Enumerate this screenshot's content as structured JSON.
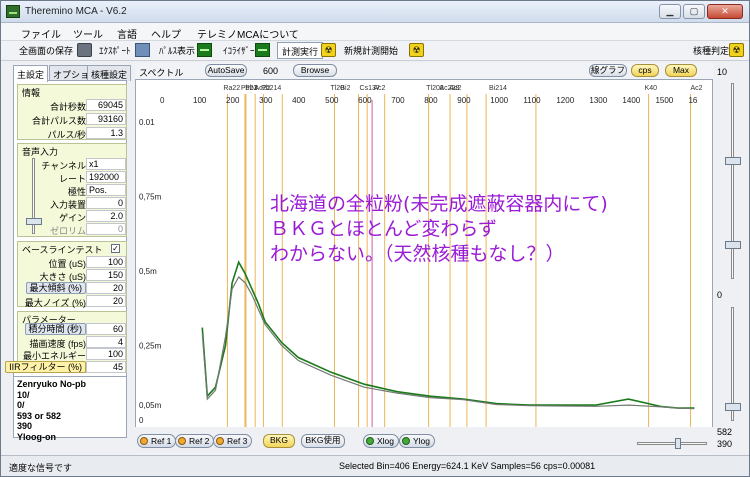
{
  "window": {
    "title": "Theremino MCA - V6.2"
  },
  "menu": [
    "ファイル",
    "ツール",
    "言語",
    "ヘルプ",
    "テレミノMCAについて"
  ],
  "toolbar": {
    "save_screen": "全画面の保存",
    "export": "ｴｸｽﾎﾟｰﾄ",
    "pulse_display": "ﾊﾟﾙｽ表示",
    "equalizer": "ｲｺﾗｲｻﾞｰ",
    "run_measure": "計測実行",
    "new_measure": "新規計測開始",
    "nuclide_identify": "核種判定"
  },
  "tabs": [
    "主設定",
    "オプション",
    "核種設定"
  ],
  "info": {
    "header": "情報",
    "rows": [
      {
        "label": "合計秒数",
        "value": "69045"
      },
      {
        "label": "合計パルス数",
        "value": "93160"
      },
      {
        "label": "パルス/秒",
        "value": "1.3"
      }
    ]
  },
  "audio": {
    "header": "音声入力",
    "rows": [
      {
        "label": "チャンネル",
        "value": "x1"
      },
      {
        "label": "レート",
        "value": "192000"
      },
      {
        "label": "極性",
        "value": "Pos."
      },
      {
        "label": "入力装置",
        "value": "0"
      },
      {
        "label": "ゲイン",
        "value": "2.0"
      },
      {
        "label": "ゼロリム",
        "value": "0"
      }
    ]
  },
  "baseline": {
    "header": "ベースラインテスト",
    "checked": "✓",
    "rows": [
      {
        "label": "位置 (uS)",
        "value": "100"
      },
      {
        "label": "大きさ (uS)",
        "value": "150"
      },
      {
        "label": "最大傾斜 (%)",
        "value": "20"
      },
      {
        "label": "最大ノイズ (%)",
        "value": "20"
      }
    ]
  },
  "params": {
    "header": "パラメーター",
    "rows": [
      {
        "label": "積分時間 (秒)",
        "value": "60"
      },
      {
        "label": "描画速度 (fps)",
        "value": "4"
      },
      {
        "label": "最小エネルギー",
        "value": "100"
      },
      {
        "label": "IIRフィルター (%)",
        "value": "45"
      }
    ]
  },
  "notes": [
    "Zenryuko    No-pb",
    "10/",
    "0/",
    "593 or 582",
    "390",
    "Yloog-on"
  ],
  "spectrum": {
    "label": "スペクトル",
    "autosave": "AutoSave",
    "autosave_value": "600",
    "browse": "Browse",
    "linegraph": "線グラフ",
    "cps": "cps",
    "max": "Max"
  },
  "axis": {
    "energy_ticks": [
      "0",
      "100",
      "200",
      "300",
      "400",
      "500",
      "600",
      "700",
      "800",
      "900",
      "1000",
      "1100",
      "1200",
      "1300",
      "1400",
      "1500",
      "16"
    ],
    "y_ticks": [
      "0.01",
      "0,75m",
      "0,5m",
      "0,25m",
      "0,05m",
      "0"
    ]
  },
  "isotopes": [
    "Ra22",
    "Pb21",
    "Pb3",
    "Ac22",
    "Pb214",
    "Tl20",
    "Bi2",
    "Cs137",
    "Ac2",
    "Tl208",
    "Ac228",
    "Ac2",
    "Bi214",
    "K40",
    "Ac2"
  ],
  "annotation": [
    "北海道の全粒粉(未完成遮蔽容器内にて)",
    "ＢＫＧとほとんど変わらず",
    "わからない。（天然核種もなし？）"
  ],
  "bottom_buttons": {
    "ref1": "Ref 1",
    "ref2": "Ref 2",
    "ref3": "Ref 3",
    "bkg": "BKG",
    "bkg_use": "BKG使用",
    "xlog": "Xlog",
    "ylog": "Ylog"
  },
  "right": {
    "top": "10",
    "mid": "0",
    "bottom1": "582",
    "bottom2": "390"
  },
  "status": {
    "left": "適度な信号です",
    "right": "Selected Bin=406  Energy=624.1 KeV  Samples=56  cps=0.00081"
  },
  "chart_data": {
    "type": "line",
    "xlabel": "",
    "ylabel": "",
    "x_unit": "keV",
    "xlim": [
      0,
      1650
    ],
    "ylim": [
      0,
      0.01
    ],
    "series": [
      {
        "x": [
          110,
          125,
          150,
          180,
          200,
          220,
          240,
          260,
          280,
          300,
          350,
          400,
          500,
          600,
          700,
          800,
          900,
          1000,
          1100,
          1200,
          1300,
          1400,
          1500,
          1550,
          1600
        ],
        "values": [
          0.0031,
          0.0008,
          0.0011,
          0.0025,
          0.0046,
          0.0053,
          0.0049,
          0.0044,
          0.0039,
          0.0033,
          0.0026,
          0.0021,
          0.0016,
          0.0012,
          0.00095,
          0.0008,
          0.0007,
          0.00055,
          0.0005,
          0.0005,
          0.0005,
          0.0007,
          0.00045,
          0.0004,
          0.0004
        ]
      },
      {
        "x": [
          110,
          125,
          150,
          180,
          200,
          220,
          240,
          260,
          280,
          300,
          350,
          400,
          500,
          600,
          700,
          800,
          900,
          1000,
          1100,
          1200,
          1300,
          1400,
          1500,
          1550,
          1600
        ],
        "values": [
          0.0029,
          0.0007,
          0.001,
          0.0028,
          0.0044,
          0.0048,
          0.0046,
          0.0042,
          0.0037,
          0.0032,
          0.0025,
          0.002,
          0.0015,
          0.0011,
          0.0009,
          0.00075,
          0.00068,
          0.00052,
          0.00048,
          0.00047,
          0.00046,
          0.0005,
          0.00044,
          0.0004,
          0.00038
        ]
      }
    ],
    "colors": [
      "#1a7a1a",
      "#707a70"
    ]
  }
}
